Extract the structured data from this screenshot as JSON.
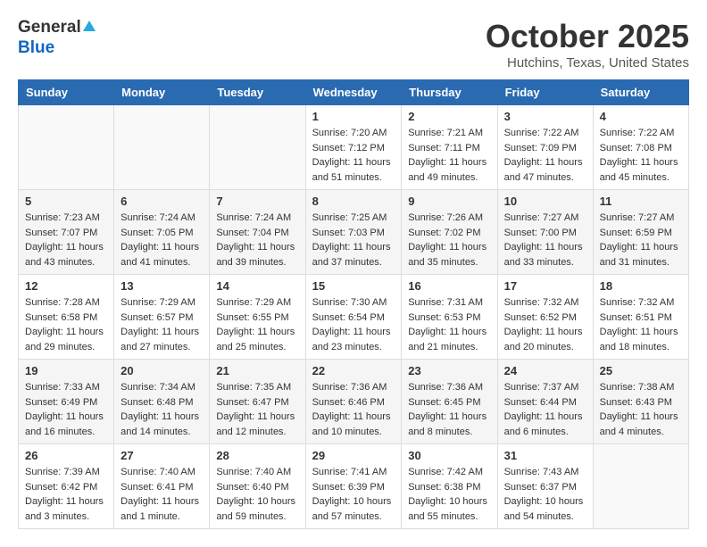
{
  "header": {
    "logo_general": "General",
    "logo_blue": "Blue",
    "month_title": "October 2025",
    "location": "Hutchins, Texas, United States"
  },
  "calendar": {
    "days_of_week": [
      "Sunday",
      "Monday",
      "Tuesday",
      "Wednesday",
      "Thursday",
      "Friday",
      "Saturday"
    ],
    "weeks": [
      [
        {
          "day": "",
          "info": ""
        },
        {
          "day": "",
          "info": ""
        },
        {
          "day": "",
          "info": ""
        },
        {
          "day": "1",
          "info": "Sunrise: 7:20 AM\nSunset: 7:12 PM\nDaylight: 11 hours\nand 51 minutes."
        },
        {
          "day": "2",
          "info": "Sunrise: 7:21 AM\nSunset: 7:11 PM\nDaylight: 11 hours\nand 49 minutes."
        },
        {
          "day": "3",
          "info": "Sunrise: 7:22 AM\nSunset: 7:09 PM\nDaylight: 11 hours\nand 47 minutes."
        },
        {
          "day": "4",
          "info": "Sunrise: 7:22 AM\nSunset: 7:08 PM\nDaylight: 11 hours\nand 45 minutes."
        }
      ],
      [
        {
          "day": "5",
          "info": "Sunrise: 7:23 AM\nSunset: 7:07 PM\nDaylight: 11 hours\nand 43 minutes."
        },
        {
          "day": "6",
          "info": "Sunrise: 7:24 AM\nSunset: 7:05 PM\nDaylight: 11 hours\nand 41 minutes."
        },
        {
          "day": "7",
          "info": "Sunrise: 7:24 AM\nSunset: 7:04 PM\nDaylight: 11 hours\nand 39 minutes."
        },
        {
          "day": "8",
          "info": "Sunrise: 7:25 AM\nSunset: 7:03 PM\nDaylight: 11 hours\nand 37 minutes."
        },
        {
          "day": "9",
          "info": "Sunrise: 7:26 AM\nSunset: 7:02 PM\nDaylight: 11 hours\nand 35 minutes."
        },
        {
          "day": "10",
          "info": "Sunrise: 7:27 AM\nSunset: 7:00 PM\nDaylight: 11 hours\nand 33 minutes."
        },
        {
          "day": "11",
          "info": "Sunrise: 7:27 AM\nSunset: 6:59 PM\nDaylight: 11 hours\nand 31 minutes."
        }
      ],
      [
        {
          "day": "12",
          "info": "Sunrise: 7:28 AM\nSunset: 6:58 PM\nDaylight: 11 hours\nand 29 minutes."
        },
        {
          "day": "13",
          "info": "Sunrise: 7:29 AM\nSunset: 6:57 PM\nDaylight: 11 hours\nand 27 minutes."
        },
        {
          "day": "14",
          "info": "Sunrise: 7:29 AM\nSunset: 6:55 PM\nDaylight: 11 hours\nand 25 minutes."
        },
        {
          "day": "15",
          "info": "Sunrise: 7:30 AM\nSunset: 6:54 PM\nDaylight: 11 hours\nand 23 minutes."
        },
        {
          "day": "16",
          "info": "Sunrise: 7:31 AM\nSunset: 6:53 PM\nDaylight: 11 hours\nand 21 minutes."
        },
        {
          "day": "17",
          "info": "Sunrise: 7:32 AM\nSunset: 6:52 PM\nDaylight: 11 hours\nand 20 minutes."
        },
        {
          "day": "18",
          "info": "Sunrise: 7:32 AM\nSunset: 6:51 PM\nDaylight: 11 hours\nand 18 minutes."
        }
      ],
      [
        {
          "day": "19",
          "info": "Sunrise: 7:33 AM\nSunset: 6:49 PM\nDaylight: 11 hours\nand 16 minutes."
        },
        {
          "day": "20",
          "info": "Sunrise: 7:34 AM\nSunset: 6:48 PM\nDaylight: 11 hours\nand 14 minutes."
        },
        {
          "day": "21",
          "info": "Sunrise: 7:35 AM\nSunset: 6:47 PM\nDaylight: 11 hours\nand 12 minutes."
        },
        {
          "day": "22",
          "info": "Sunrise: 7:36 AM\nSunset: 6:46 PM\nDaylight: 11 hours\nand 10 minutes."
        },
        {
          "day": "23",
          "info": "Sunrise: 7:36 AM\nSunset: 6:45 PM\nDaylight: 11 hours\nand 8 minutes."
        },
        {
          "day": "24",
          "info": "Sunrise: 7:37 AM\nSunset: 6:44 PM\nDaylight: 11 hours\nand 6 minutes."
        },
        {
          "day": "25",
          "info": "Sunrise: 7:38 AM\nSunset: 6:43 PM\nDaylight: 11 hours\nand 4 minutes."
        }
      ],
      [
        {
          "day": "26",
          "info": "Sunrise: 7:39 AM\nSunset: 6:42 PM\nDaylight: 11 hours\nand 3 minutes."
        },
        {
          "day": "27",
          "info": "Sunrise: 7:40 AM\nSunset: 6:41 PM\nDaylight: 11 hours\nand 1 minute."
        },
        {
          "day": "28",
          "info": "Sunrise: 7:40 AM\nSunset: 6:40 PM\nDaylight: 10 hours\nand 59 minutes."
        },
        {
          "day": "29",
          "info": "Sunrise: 7:41 AM\nSunset: 6:39 PM\nDaylight: 10 hours\nand 57 minutes."
        },
        {
          "day": "30",
          "info": "Sunrise: 7:42 AM\nSunset: 6:38 PM\nDaylight: 10 hours\nand 55 minutes."
        },
        {
          "day": "31",
          "info": "Sunrise: 7:43 AM\nSunset: 6:37 PM\nDaylight: 10 hours\nand 54 minutes."
        },
        {
          "day": "",
          "info": ""
        }
      ]
    ]
  }
}
